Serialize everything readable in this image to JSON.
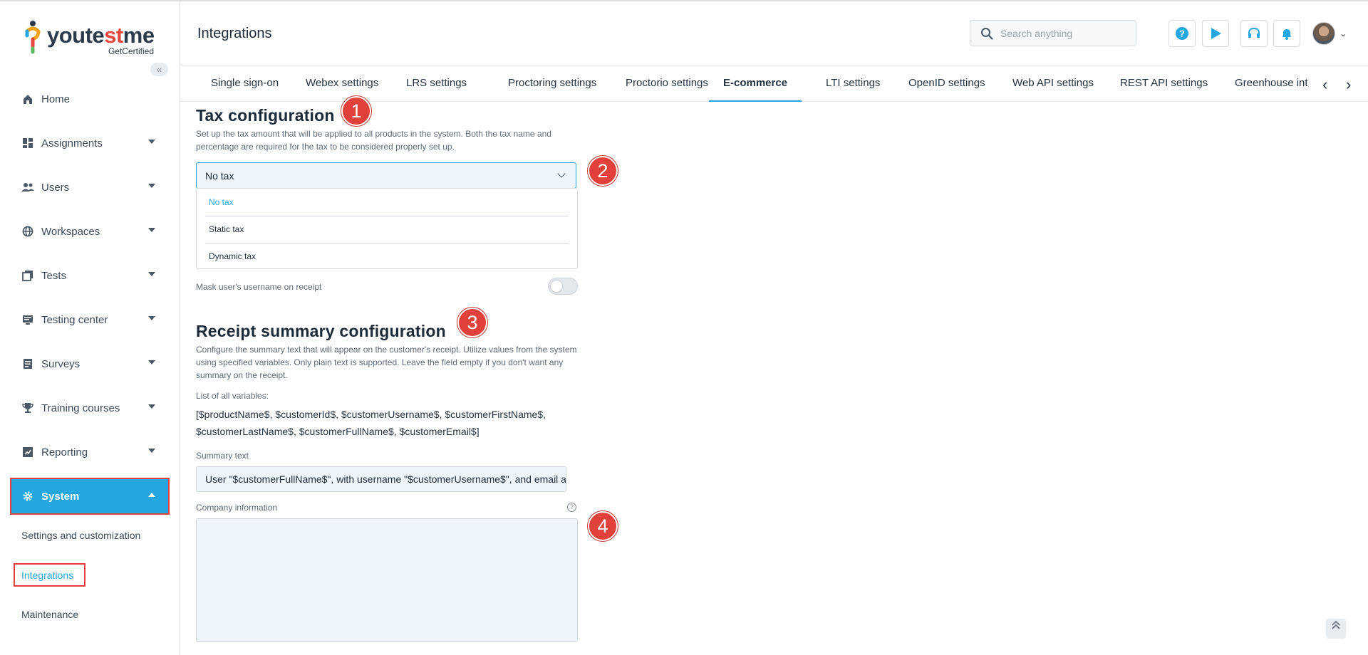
{
  "brand": {
    "logo_part1": "youte",
    "logo_part2": "st",
    "logo_part3": "me",
    "subtitle": "GetCertified"
  },
  "sidebar": {
    "collapse_glyph": "«",
    "items": [
      {
        "label": "Home",
        "icon": "home-icon"
      },
      {
        "label": "Assignments",
        "icon": "assignments-icon"
      },
      {
        "label": "Users",
        "icon": "users-icon"
      },
      {
        "label": "Workspaces",
        "icon": "globe-icon"
      },
      {
        "label": "Tests",
        "icon": "tests-icon"
      },
      {
        "label": "Testing center",
        "icon": "monitor-icon"
      },
      {
        "label": "Surveys",
        "icon": "surveys-icon"
      },
      {
        "label": "Training courses",
        "icon": "trophy-icon"
      },
      {
        "label": "Reporting",
        "icon": "reporting-icon"
      },
      {
        "label": "System",
        "icon": "gear-icon"
      }
    ],
    "sub_items": [
      "Settings and customization",
      "Integrations",
      "Maintenance"
    ]
  },
  "header": {
    "title": "Integrations",
    "search_placeholder": "Search anything"
  },
  "tabs": [
    "Single sign-on",
    "Webex settings",
    "LRS settings",
    "Proctoring settings",
    "Proctorio settings",
    "E-commerce",
    "LTI settings",
    "OpenID settings",
    "Web API settings",
    "REST API settings",
    "Greenhouse integrat"
  ],
  "tax": {
    "title": "Tax configuration",
    "description_line1": "Set up the tax amount that will be applied to all products in the system. Both the tax name and",
    "description_line2": "percentage are required for the tax to be considered properly set up.",
    "selected": "No tax",
    "options": [
      "No tax",
      "Static tax",
      "Dynamic tax"
    ],
    "mask_label": "Mask user's username on receipt"
  },
  "receipt": {
    "title": "Receipt summary configuration",
    "description_line1": "Configure the summary text that will appear on the customer's receipt. Utilize values from the system",
    "description_line2": "using specified variables. Only plain text is supported. Leave the field empty if you don't want any",
    "description_line3": "summary on the receipt.",
    "vars_label": "List of all variables:",
    "vars_line1": "[$productName$, $customerId$, $customerUsername$, $customerFirstName$,",
    "vars_line2": "$customerLastName$, $customerFullName$, $customerEmail$]",
    "summary_label": "Summary text",
    "summary_value": "User \"$customerFullName$\", with username \"$customerUsername$\", and email a",
    "company_label": "Company information",
    "help_glyph": "?"
  },
  "badges": [
    "1",
    "2",
    "3",
    "4"
  ],
  "colors": {
    "accent": "#24a6e0",
    "highlight": "#e0423b",
    "badge": "#e2403a"
  }
}
